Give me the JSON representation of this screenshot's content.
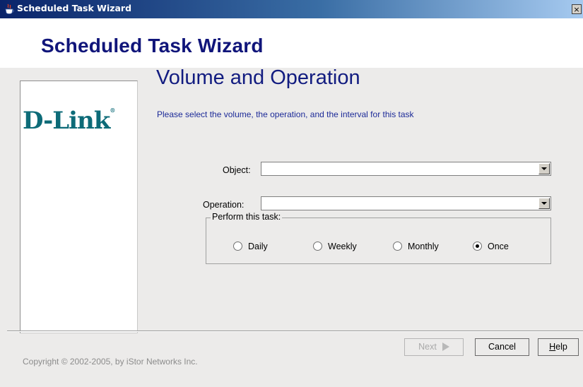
{
  "window": {
    "title": "Scheduled Task Wizard",
    "close_glyph": "×"
  },
  "header": {
    "title": "Scheduled Task Wizard"
  },
  "logo": {
    "brand": "D-Link",
    "reg_mark": "®"
  },
  "page": {
    "title": "Volume and Operation",
    "description": "Please select the volume, the operation, and the interval for this task"
  },
  "fields": {
    "object": {
      "label": "Object:",
      "value": ""
    },
    "operation": {
      "label": "Operation:",
      "value": ""
    }
  },
  "schedule": {
    "legend": "Perform this task:",
    "options": [
      {
        "label": "Daily",
        "selected": false
      },
      {
        "label": "Weekly",
        "selected": false
      },
      {
        "label": "Monthly",
        "selected": false
      },
      {
        "label": "Once",
        "selected": true
      }
    ]
  },
  "buttons": {
    "next": {
      "label": "Next",
      "enabled": false
    },
    "cancel": {
      "label": "Cancel"
    },
    "help": {
      "first": "H",
      "rest": "elp"
    }
  },
  "footer": {
    "copyright": "Copyright © 2002-2005, by iStor Networks Inc."
  },
  "icons": {
    "window_icon": "java-cup-icon",
    "dropdown": "chevron-down-icon",
    "next_arrow": "triangle-right-icon"
  }
}
